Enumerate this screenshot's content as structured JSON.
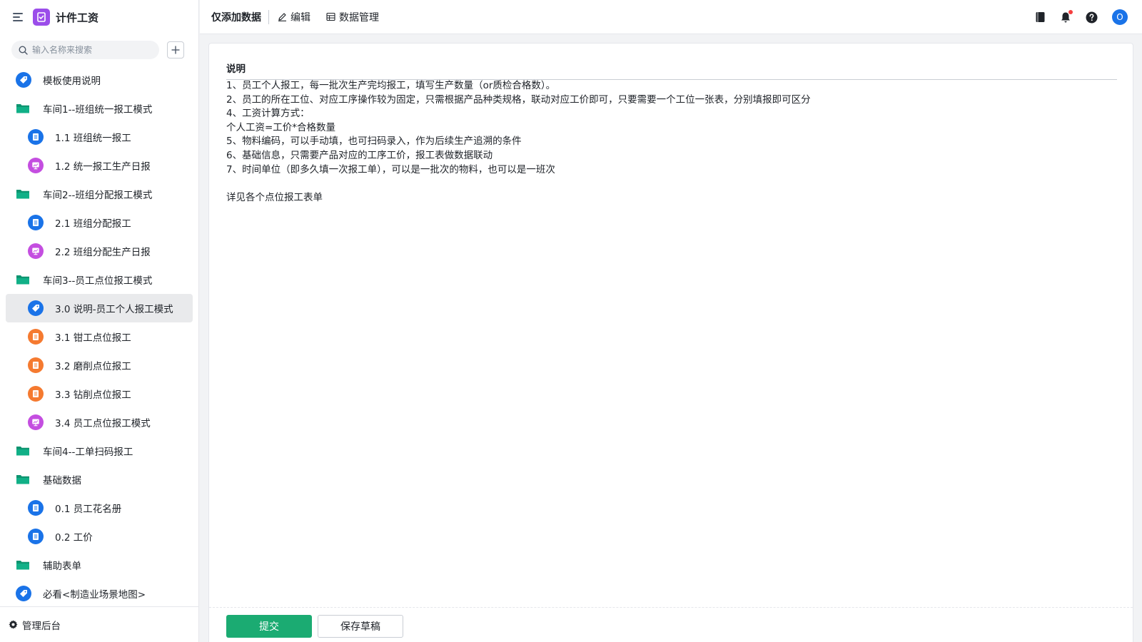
{
  "colors": {
    "accent_green": "#1bab72",
    "folder_teal": "#11b087",
    "icon_blue": "#1a73e8",
    "icon_purple": "#c44ee0",
    "icon_orange": "#f57a30",
    "app_purple": "#9b4dea"
  },
  "app": {
    "name": "计件工资",
    "logo_icon": "checklist-icon"
  },
  "sidebar": {
    "search_placeholder": "输入名称来搜索",
    "items": [
      {
        "label": "模板使用说明",
        "kind": "tag",
        "level": 0
      },
      {
        "label": "车间1--班组统一报工模式",
        "kind": "folder",
        "level": 0
      },
      {
        "label": "1.1 班组统一报工",
        "kind": "form-blue",
        "level": 1
      },
      {
        "label": "1.2 统一报工生产日报",
        "kind": "report-purple",
        "level": 1
      },
      {
        "label": "车间2--班组分配报工模式",
        "kind": "folder",
        "level": 0
      },
      {
        "label": "2.1 班组分配报工",
        "kind": "form-blue",
        "level": 1
      },
      {
        "label": "2.2 班组分配生产日报",
        "kind": "report-purple",
        "level": 1
      },
      {
        "label": "车间3--员工点位报工模式",
        "kind": "folder",
        "level": 0
      },
      {
        "label": "3.0 说明-员工个人报工模式",
        "kind": "tag",
        "level": 1,
        "active": true
      },
      {
        "label": "3.1 钳工点位报工",
        "kind": "form-orange",
        "level": 1
      },
      {
        "label": "3.2 磨削点位报工",
        "kind": "form-orange",
        "level": 1
      },
      {
        "label": "3.3 钻削点位报工",
        "kind": "form-orange",
        "level": 1
      },
      {
        "label": "3.4 员工点位报工模式",
        "kind": "report-purple",
        "level": 1
      },
      {
        "label": "车间4--工单扫码报工",
        "kind": "folder",
        "level": 0
      },
      {
        "label": "基础数据",
        "kind": "folder",
        "level": 0
      },
      {
        "label": "0.1 员工花名册",
        "kind": "form-blue",
        "level": 1
      },
      {
        "label": "0.2 工价",
        "kind": "form-blue",
        "level": 1
      },
      {
        "label": "辅助表单",
        "kind": "folder",
        "level": 0
      },
      {
        "label": "必看<制造业场景地图>",
        "kind": "tag",
        "level": 0
      }
    ],
    "footer_label": "管理后台"
  },
  "topbar": {
    "title": "仅添加数据",
    "edit_label": "编辑",
    "data_manage_label": "数据管理",
    "avatar_text": "O"
  },
  "content": {
    "section_title": "说明",
    "lines": [
      "1、员工个人报工，每一批次生产完均报工，填写生产数量（or质检合格数）。",
      "2、员工的所在工位、对应工序操作较为固定，只需根据产品种类规格，联动对应工价即可，只要需要一个工位一张表，分别填报即可区分",
      "4、工资计算方式：",
      "个人工资=工价*合格数量",
      "5、物料编码，可以手动填，也可扫码录入，作为后续生产追溯的条件",
      "6、基础信息，只需要产品对应的工序工价，报工表做数据联动",
      "7、时间单位（即多久填一次报工单），可以是一批次的物料，也可以是一班次",
      "",
      "详见各个点位报工表单"
    ],
    "submit_label": "提交",
    "draft_label": "保存草稿"
  }
}
